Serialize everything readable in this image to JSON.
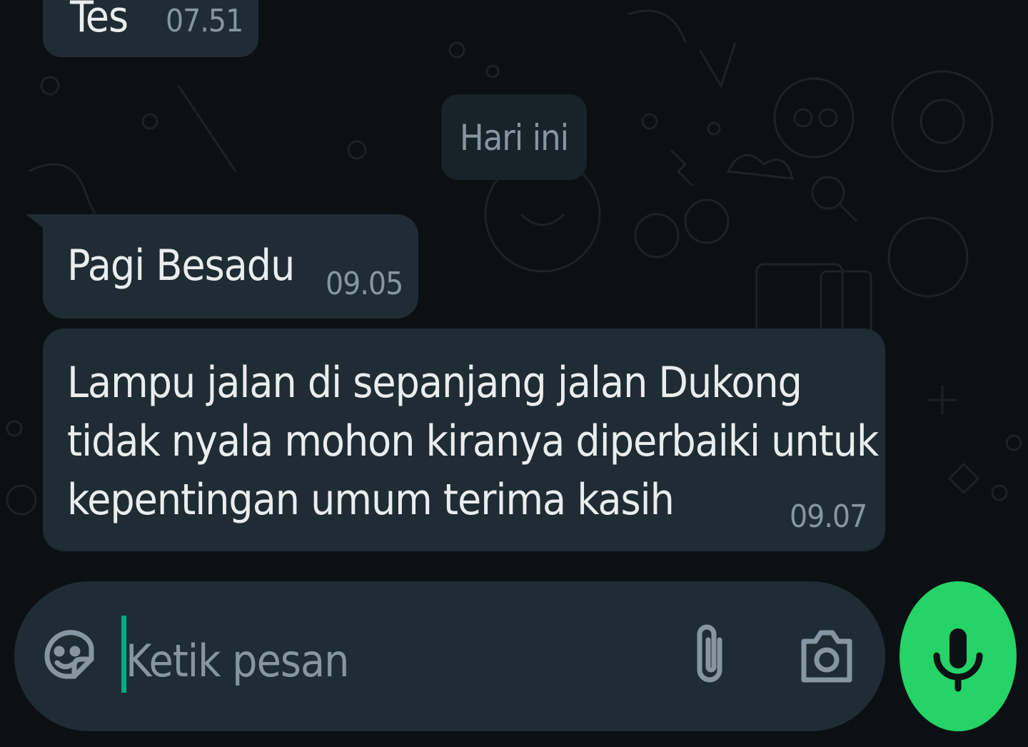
{
  "colors": {
    "background": "#0b1014",
    "bubble_incoming": "#202c33",
    "date_chip": "#182229",
    "composer": "#1f2c34",
    "accent_green": "#25d366",
    "cursor": "#00a884",
    "text_primary": "#e9edef",
    "text_secondary": "#8696a0"
  },
  "chat": {
    "messages_top": [
      {
        "text": "Tes",
        "time": "07.51"
      }
    ],
    "date_separator": "Hari ini",
    "messages": [
      {
        "text": "Pagi Besadu",
        "time": "09.05"
      },
      {
        "lines": [
          "Lampu jalan di sepanjang jalan Dukong",
          "tidak nyala mohon kiranya diperbaiki untuk",
          "kepentingan umum terima kasih"
        ],
        "time": "09.07"
      }
    ]
  },
  "composer": {
    "emoji_icon": "sticker-icon",
    "placeholder": "Ketik pesan",
    "value": "",
    "attach_icon": "paperclip-icon",
    "camera_icon": "camera-icon",
    "voice_icon": "microphone-icon"
  }
}
